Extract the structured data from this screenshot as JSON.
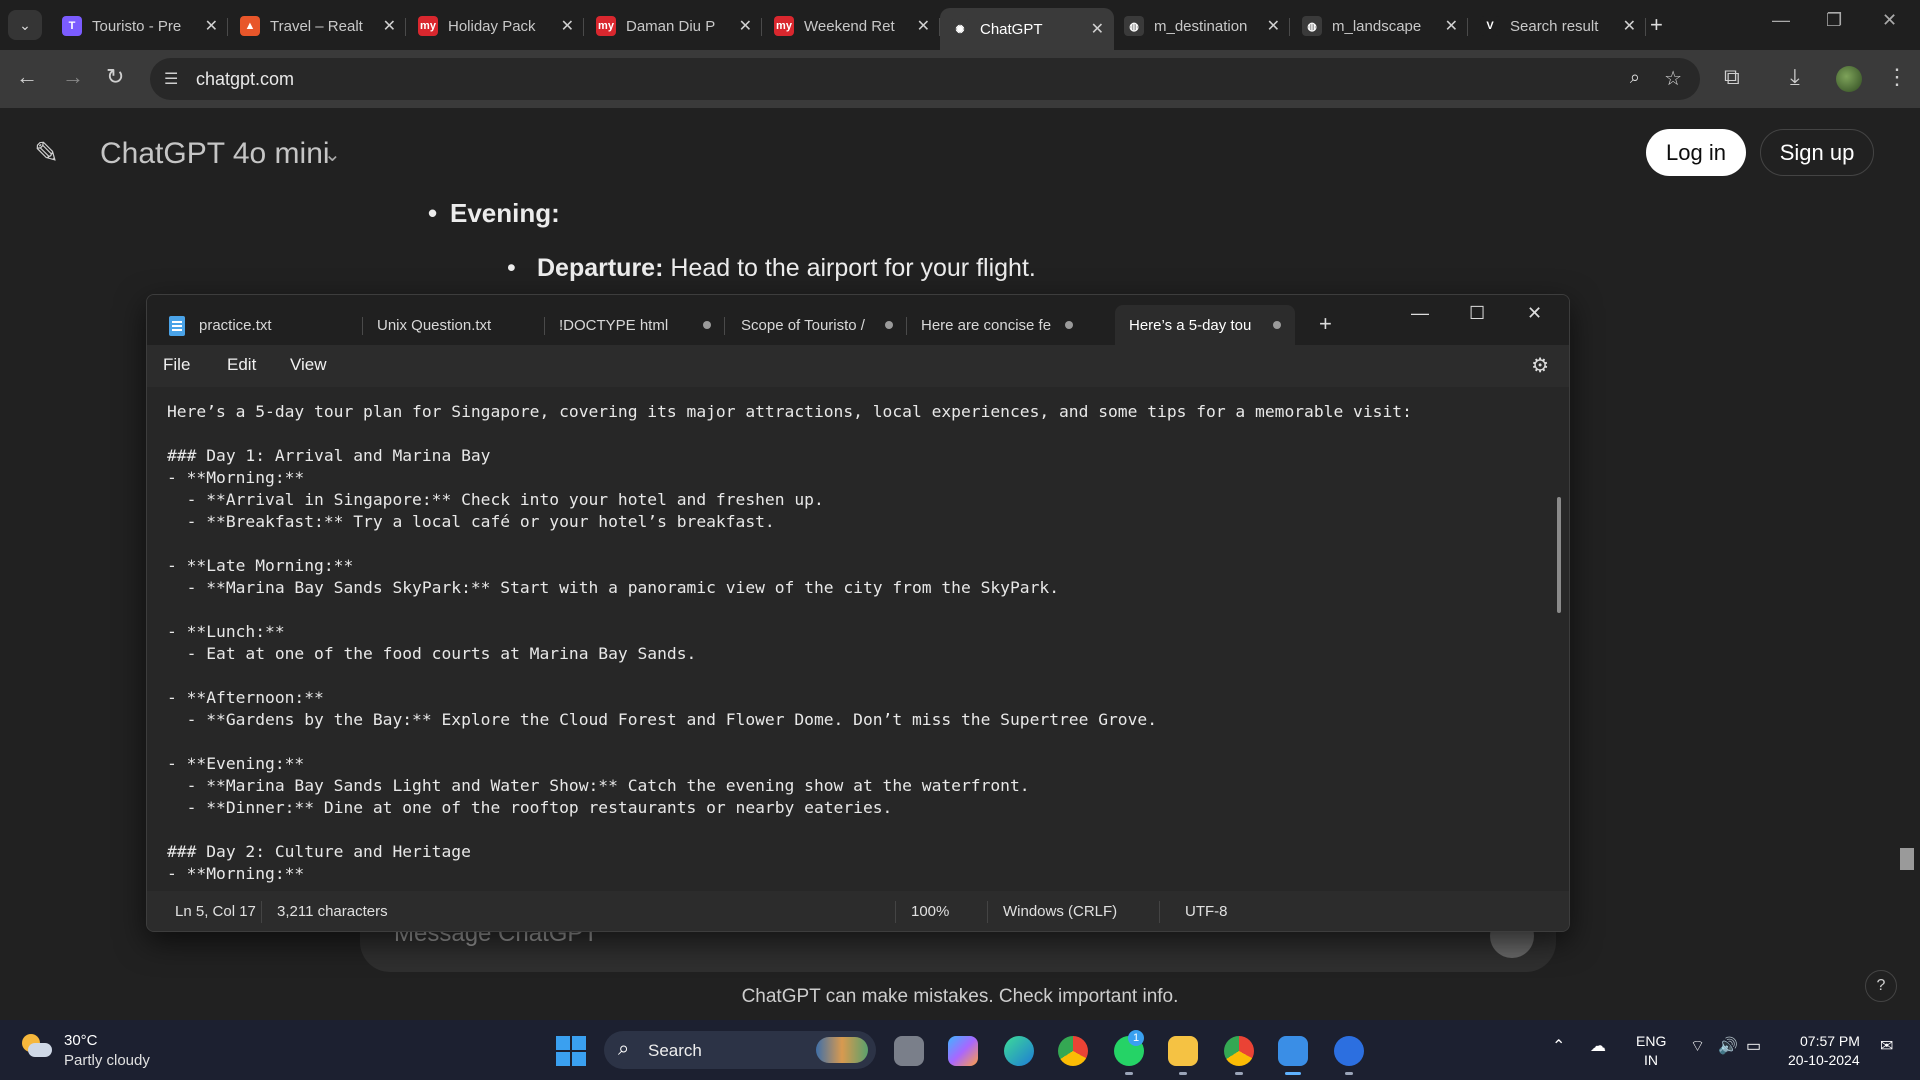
{
  "browser": {
    "tabs": [
      {
        "title": "Touristo - Pre",
        "favicon": "touristo-icon",
        "color": "#7b5cff",
        "glyph": "T"
      },
      {
        "title": "Travel – Realt",
        "favicon": "fire-icon",
        "color": "#e8562a",
        "glyph": "▲"
      },
      {
        "title": "Holiday Pack",
        "favicon": "mmt-icon",
        "color": "#d9272e",
        "glyph": "my"
      },
      {
        "title": "Daman Diu P",
        "favicon": "mmt-icon",
        "color": "#d9272e",
        "glyph": "my"
      },
      {
        "title": "Weekend Ret",
        "favicon": "mmt-icon",
        "color": "#d9272e",
        "glyph": "my"
      },
      {
        "title": "ChatGPT",
        "favicon": "openai-icon",
        "color": "#3a3a3a",
        "glyph": "✺"
      },
      {
        "title": "m_destination",
        "favicon": "globe-icon",
        "color": "#3a3a3a",
        "glyph": "◍"
      },
      {
        "title": "m_landscape",
        "favicon": "globe-icon",
        "color": "#3a3a3a",
        "glyph": "◍"
      },
      {
        "title": "Search result",
        "favicon": "vuetify-icon",
        "color": "#1f1f1f",
        "glyph": "V"
      }
    ],
    "url": "chatgpt.com"
  },
  "chatgpt": {
    "model": "ChatGPT 4o mini",
    "login": "Log in",
    "signup": "Sign up",
    "bullet_evening": "Evening:",
    "bullet_departure_bold": "Departure:",
    "bullet_departure_text": " Head to the airport for your flight.",
    "message_placeholder": "Message ChatGPT",
    "disclaimer": "ChatGPT can make mistakes. Check important info.",
    "help": "?"
  },
  "notepad": {
    "tabs": [
      {
        "label": "practice.txt",
        "dirty": false
      },
      {
        "label": "Unix Question.txt",
        "dirty": false
      },
      {
        "label": "!DOCTYPE html",
        "dirty": true
      },
      {
        "label": "Scope of Touristo /",
        "dirty": true
      },
      {
        "label": "Here are concise fe",
        "dirty": true
      },
      {
        "label": "Here’s a 5-day tou",
        "dirty": true
      }
    ],
    "menu": {
      "file": "File",
      "edit": "Edit",
      "view": "View"
    },
    "lines": [
      "Here’s a 5-day tour plan for Singapore, covering its major attractions, local experiences, and some tips for a memorable visit:",
      "",
      "### Day 1: Arrival and Marina Bay",
      "- **Morning:**",
      "  - **Arrival in Singapore:** Check into your hotel and freshen up.",
      "  - **Breakfast:** Try a local café or your hotel’s breakfast.",
      "",
      "- **Late Morning:**",
      "  - **Marina Bay Sands SkyPark:** Start with a panoramic view of the city from the SkyPark.",
      "",
      "- **Lunch:**",
      "  - Eat at one of the food courts at Marina Bay Sands.",
      "",
      "- **Afternoon:**",
      "  - **Gardens by the Bay:** Explore the Cloud Forest and Flower Dome. Don’t miss the Supertree Grove.",
      "",
      "- **Evening:**",
      "  - **Marina Bay Sands Light and Water Show:** Catch the evening show at the waterfront.",
      "  - **Dinner:** Dine at one of the rooftop restaurants or nearby eateries.",
      "",
      "### Day 2: Culture and Heritage",
      "- **Morning:**"
    ],
    "status": {
      "position": "Ln 5, Col 17",
      "characters": "3,211 characters",
      "zoom": "100%",
      "line_ending": "Windows (CRLF)",
      "encoding": "UTF-8"
    }
  },
  "taskbar": {
    "temperature": "30°C",
    "weather": "Partly cloudy",
    "search_label": "Search",
    "whatsapp_badge": "1",
    "lang_line1": "ENG",
    "lang_line2": "IN",
    "time": "07:57 PM",
    "date": "20-10-2024"
  },
  "colors": {
    "accent": "#3aa0f0",
    "background": "#212121",
    "spellcheck": "#e04040"
  }
}
